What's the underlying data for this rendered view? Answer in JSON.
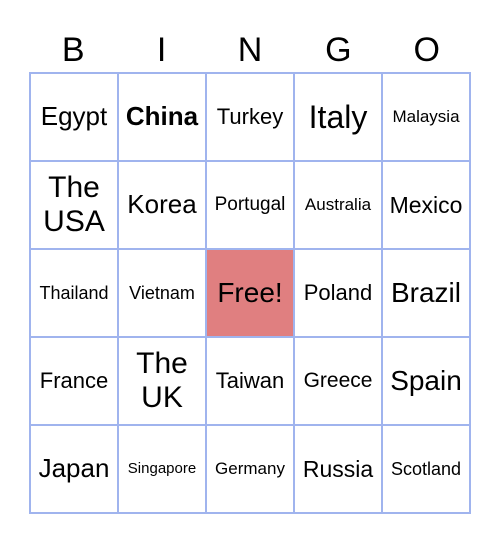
{
  "header": [
    "B",
    "I",
    "N",
    "G",
    "O"
  ],
  "cells": [
    "Egypt",
    "China",
    "Turkey",
    "Italy",
    "Malaysia",
    "The USA",
    "Korea",
    "Portugal",
    "Australia",
    "Mexico",
    "Thailand",
    "Vietnam",
    "Free!",
    "Poland",
    "Brazil",
    "France",
    "The UK",
    "Taiwan",
    "Greece",
    "Spain",
    "Japan",
    "Singapore",
    "Germany",
    "Russia",
    "Scotland"
  ],
  "free_color": "#e07f80",
  "border_color": "#a0b4ee"
}
